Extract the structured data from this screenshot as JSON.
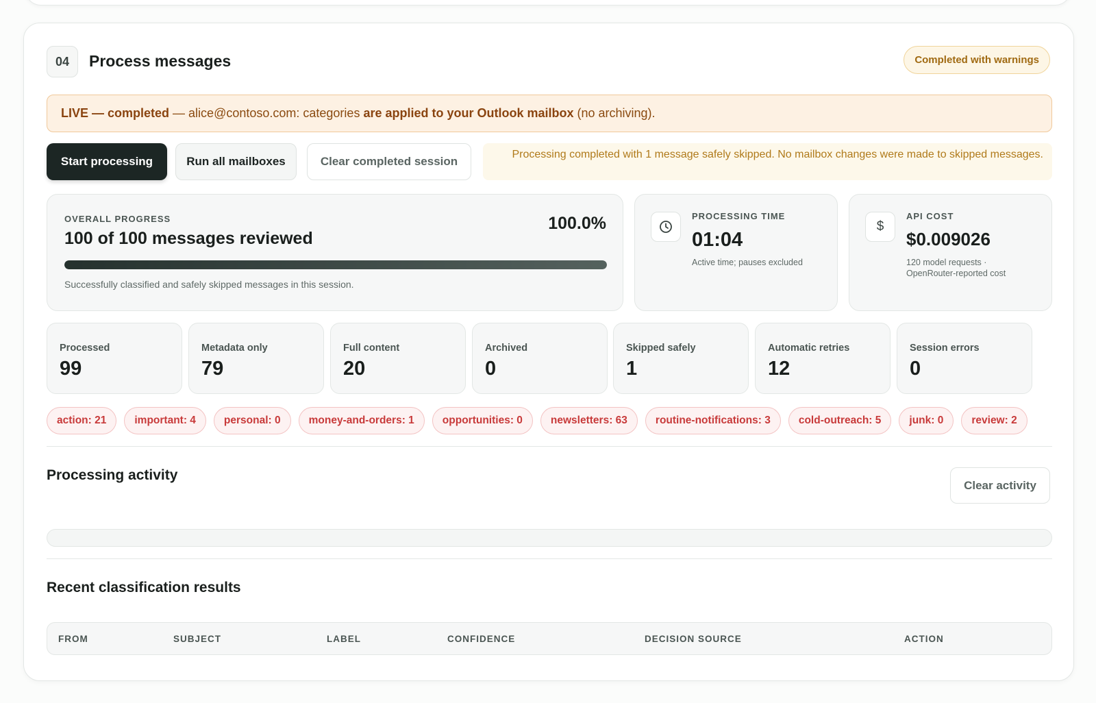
{
  "step": {
    "number": "04",
    "title": "Process messages",
    "status": "Completed with warnings"
  },
  "banner": {
    "live": "LIVE — completed",
    "sep": " — ",
    "mid": "alice@contoso.com: categories ",
    "strong": "are applied to your Outlook mailbox",
    "end": " (no archiving)."
  },
  "actions": {
    "start": "Start processing",
    "run_all": "Run all mailboxes",
    "clear_session": "Clear completed session"
  },
  "notice": "Processing completed with 1 message safely skipped. No mailbox changes were made to skipped messages.",
  "progress": {
    "overline": "OVERALL PROGRESS",
    "title": "100 of 100 messages reviewed",
    "percent_text": "100.0%",
    "fraction": 1.0,
    "description": "Successfully classified and safely skipped messages in this session."
  },
  "time": {
    "icon": "clock-icon",
    "overline": "PROCESSING TIME",
    "value": "01:04",
    "sub": "Active time; pauses excluded"
  },
  "cost": {
    "icon": "dollar-icon",
    "overline": "API COST",
    "value": "$0.009026",
    "sub": "120 model requests · OpenRouter-reported cost"
  },
  "stats": [
    {
      "label": "Processed",
      "value": "99"
    },
    {
      "label": "Metadata only",
      "value": "79"
    },
    {
      "label": "Full content",
      "value": "20"
    },
    {
      "label": "Archived",
      "value": "0"
    },
    {
      "label": "Skipped safely",
      "value": "1"
    },
    {
      "label": "Automatic retries",
      "value": "12"
    },
    {
      "label": "Session errors",
      "value": "0"
    }
  ],
  "chips": [
    "action: 21",
    "important: 4",
    "personal: 0",
    "money-and-orders: 1",
    "opportunities: 0",
    "newsletters: 63",
    "routine-notifications: 3",
    "cold-outreach: 5",
    "junk: 0",
    "review: 2"
  ],
  "activity": {
    "title": "Processing activity",
    "clear": "Clear activity"
  },
  "results": {
    "title": "Recent classification results",
    "columns": [
      "FROM",
      "SUBJECT",
      "LABEL",
      "CONFIDENCE",
      "DECISION SOURCE",
      "ACTION"
    ]
  },
  "colors": {
    "primary": "#1c2624",
    "warning": "#a06a12",
    "chip_text": "#c83a3a"
  }
}
